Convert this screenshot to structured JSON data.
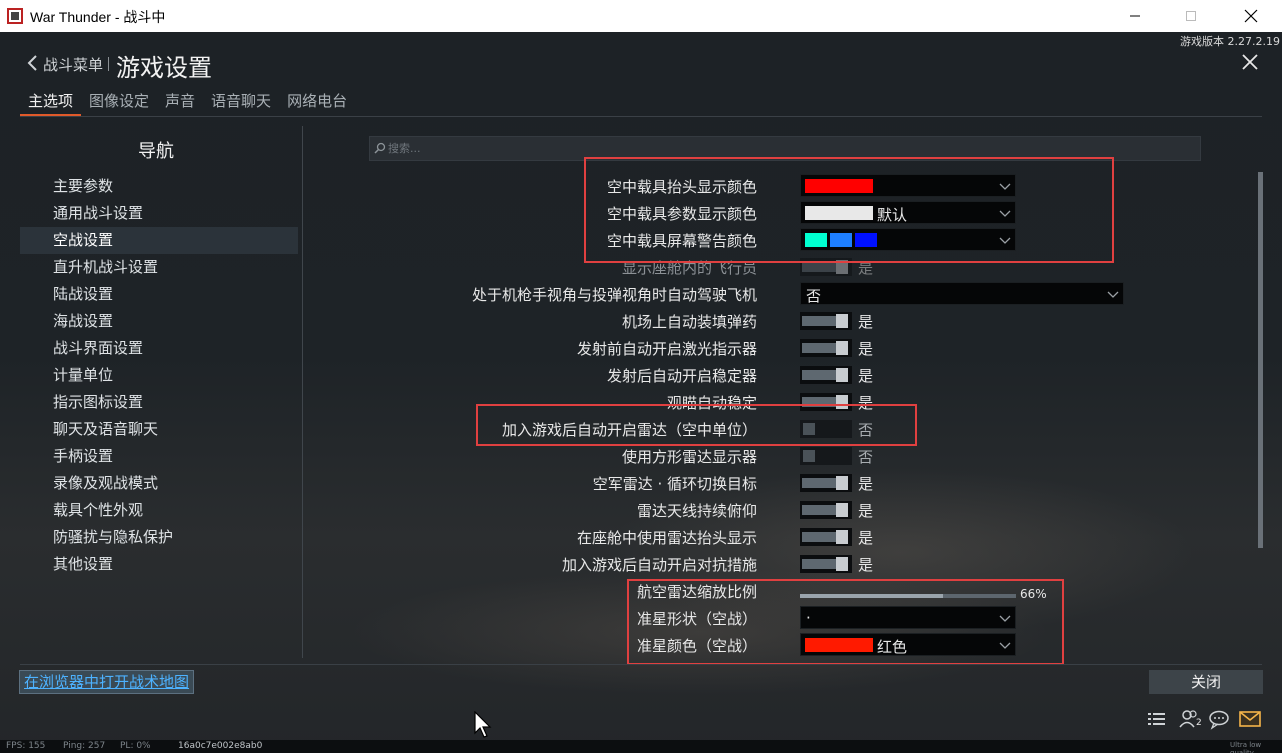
{
  "window": {
    "title": "War Thunder - 战斗中"
  },
  "header": {
    "version": "游戏版本 2.27.2.19",
    "back_label": "战斗菜单",
    "page_title": "游戏设置"
  },
  "tabs": [
    {
      "label": "主选项",
      "active": true
    },
    {
      "label": "图像设定",
      "active": false
    },
    {
      "label": "声音",
      "active": false
    },
    {
      "label": "语音聊天",
      "active": false
    },
    {
      "label": "网络电台",
      "active": false
    }
  ],
  "nav": {
    "title": "导航",
    "items": [
      {
        "label": "主要参数"
      },
      {
        "label": "通用战斗设置"
      },
      {
        "label": "空战设置",
        "selected": true
      },
      {
        "label": "直升机战斗设置"
      },
      {
        "label": "陆战设置"
      },
      {
        "label": "海战设置"
      },
      {
        "label": "战斗界面设置"
      },
      {
        "label": "计量单位"
      },
      {
        "label": "指示图标设置"
      },
      {
        "label": "聊天及语音聊天"
      },
      {
        "label": "手柄设置"
      },
      {
        "label": "录像及观战模式"
      },
      {
        "label": "载具个性外观"
      },
      {
        "label": "防骚扰与隐私保护"
      },
      {
        "label": "其他设置"
      }
    ]
  },
  "search": {
    "placeholder": "搜索..."
  },
  "settings": [
    {
      "label": "空中载具抬头显示颜色",
      "type": "color",
      "colors": [
        "#ff0000"
      ],
      "text": ""
    },
    {
      "label": "空中载具参数显示颜色",
      "type": "color",
      "colors": [
        "#e8e8e8"
      ],
      "text": "默认"
    },
    {
      "label": "空中载具屏幕警告颜色",
      "type": "color",
      "colors": [
        "#00ffd0",
        "#1e7fff",
        "#0010ff"
      ],
      "text": ""
    },
    {
      "label": "显示座舱内的飞行员",
      "type": "toggle",
      "on": true,
      "text": "是",
      "faded": true
    },
    {
      "label": "处于机枪手视角与投弹视角时自动驾驶飞机",
      "type": "select",
      "text": "否"
    },
    {
      "label": "机场上自动装填弹药",
      "type": "toggle",
      "on": true,
      "text": "是"
    },
    {
      "label": "发射前自动开启激光指示器",
      "type": "toggle",
      "on": true,
      "text": "是"
    },
    {
      "label": "发射后自动开启稳定器",
      "type": "toggle",
      "on": true,
      "text": "是"
    },
    {
      "label": "观瞄自动稳定",
      "type": "toggle",
      "on": true,
      "text": "是"
    },
    {
      "label": "加入游戏后自动开启雷达（空中单位）",
      "type": "toggle",
      "on": false,
      "text": "否"
    },
    {
      "label": "使用方形雷达显示器",
      "type": "toggle",
      "on": false,
      "text": "否"
    },
    {
      "label": "空军雷达 · 循环切换目标",
      "type": "toggle",
      "on": true,
      "text": "是"
    },
    {
      "label": "雷达天线持续俯仰",
      "type": "toggle",
      "on": true,
      "text": "是"
    },
    {
      "label": "在座舱中使用雷达抬头显示",
      "type": "toggle",
      "on": true,
      "text": "是"
    },
    {
      "label": "加入游戏后自动开启对抗措施",
      "type": "toggle",
      "on": true,
      "text": "是"
    },
    {
      "label": "航空雷达缩放比例",
      "type": "slider",
      "value": 0.66,
      "text": "66%"
    },
    {
      "label": "准星形状（空战）",
      "type": "select",
      "text": "·"
    },
    {
      "label": "准星颜色（空战）",
      "type": "color",
      "colors": [
        "#ff1a00"
      ],
      "text": "红色"
    }
  ],
  "footer": {
    "map_link": "在浏览器中打开战术地图",
    "close_label": "关闭"
  },
  "status": {
    "fps": "FPS: 155",
    "ping": "Ping: 257",
    "pl": "PL: 0%",
    "session": "16a0c7e002e8ab0",
    "quality": "Ultra low quality"
  },
  "icons": {
    "notification_badge": "2"
  },
  "accent_colors": {
    "tab_underline": "#e05a2a",
    "highlight_box": "#e04040",
    "link": "#4db2ff",
    "mail_icon": "#f5b54a"
  }
}
